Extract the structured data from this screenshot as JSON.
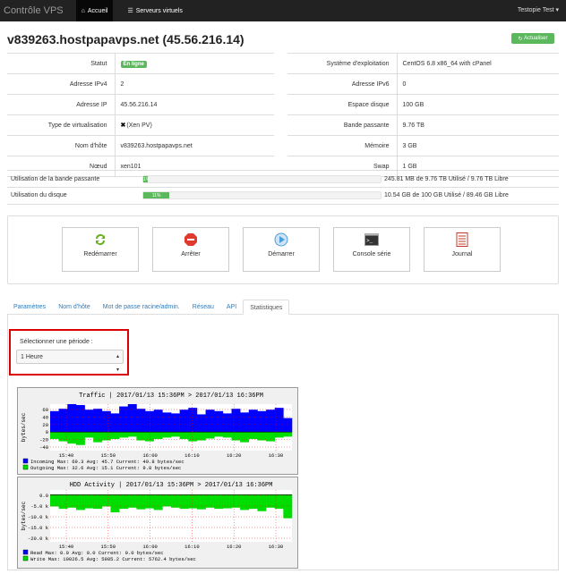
{
  "navbar": {
    "brand": "Contrôle VPS",
    "home": "Accueil",
    "servers": "Serveurs virtuels",
    "user": "Testopie Test ▾"
  },
  "header": {
    "title": "v839263.hostpapavps.net (45.56.216.14)",
    "refresh": "Actualiser"
  },
  "left_info": [
    {
      "label": "Statut",
      "value": "En ligne",
      "badge": true
    },
    {
      "label": "Adresse IPv4",
      "value": "2"
    },
    {
      "label": "Adresse IP",
      "value": "45.56.216.14"
    },
    {
      "label": "Type de virtualisation",
      "value": "(Xen PV)",
      "icon": "x-icon"
    },
    {
      "label": "Nom d'hôte",
      "value": "v839263.hostpapavps.net"
    },
    {
      "label": "Nœud",
      "value": "xen101"
    }
  ],
  "right_info": [
    {
      "label": "Système d'exploitation",
      "value": "CentOS 6.8 x86_64 with cPanel"
    },
    {
      "label": "Adresse IPv6",
      "value": "0"
    },
    {
      "label": "Espace disque",
      "value": "100 GB"
    },
    {
      "label": "Bande passante",
      "value": "9.76 TB"
    },
    {
      "label": "Mémoire",
      "value": "3 GB"
    },
    {
      "label": "Swap",
      "value": "1 GB"
    }
  ],
  "usage": [
    {
      "label": "Utilisation de la bande passante",
      "percent": 0.02,
      "bar_label": "1%",
      "text": "245.81 MB de 9.76 TB Utilisé / 9.76 TB Libre"
    },
    {
      "label": "Utilisation du disque",
      "percent": 0.11,
      "bar_label": "11%",
      "text": "10.54 GB de 100 GB Utilisé / 89.46 GB Libre"
    }
  ],
  "actions": [
    {
      "label": "Redémarrer",
      "icon": "refresh-icon",
      "color": "#6ab023"
    },
    {
      "label": "Arrêter",
      "icon": "stop-icon",
      "color": "#e03a2e"
    },
    {
      "label": "Démarrer",
      "icon": "play-icon",
      "color": "#4a9fd8"
    },
    {
      "label": "Console série",
      "icon": "terminal-icon",
      "color": "#333333"
    },
    {
      "label": "Journal",
      "icon": "notebook-icon",
      "color": "#c0392b"
    }
  ],
  "tabs": [
    "Paramètres",
    "Nom d'hôte",
    "Mot de passe racine/admin.",
    "Réseau",
    "API",
    "Statistiques"
  ],
  "active_tab": "Statistiques",
  "period": {
    "label": "Sélectionner une période :",
    "selected": "1 Heure"
  },
  "traffic": {
    "title": "Traffic | 2017/01/13 15:36PM > 2017/01/13 16:36PM",
    "ylabel": "bytes/sec",
    "yticks": [
      "60",
      "40",
      "20",
      "0",
      "-20",
      "-40"
    ],
    "xticks": [
      "15:40",
      "15:50",
      "16:00",
      "16:10",
      "16:20",
      "16:30"
    ],
    "legend": [
      {
        "color": "#0000ff",
        "text": "Incoming  Max:  69.3    Avg:  45.7    Current:  49.8    bytes/sec"
      },
      {
        "color": "#00dd00",
        "text": "Outgoing  Max:  32.6    Avg:  15.1    Current:   9.8    bytes/sec"
      }
    ],
    "chart_data": {
      "type": "area",
      "title": "Traffic | 2017/01/13 15:36PM > 2017/01/13 16:36PM",
      "ylabel": "bytes/sec",
      "ylim": [
        -40,
        60
      ],
      "series": [
        {
          "name": "Incoming",
          "values": [
            45,
            50,
            60,
            58,
            48,
            50,
            45,
            40,
            55,
            60,
            50,
            45,
            48,
            42,
            40,
            48,
            52,
            38,
            48,
            45,
            40,
            50,
            42,
            48,
            45,
            48,
            52,
            30
          ]
        },
        {
          "name": "Outgoing",
          "values": [
            -15,
            -20,
            -25,
            -28,
            -12,
            -22,
            -18,
            -15,
            -12,
            -10,
            -18,
            -20,
            -15,
            -12,
            -10,
            -15,
            -20,
            -18,
            -14,
            -10,
            -12,
            -18,
            -22,
            -15,
            -18,
            -20,
            -12,
            -10
          ]
        }
      ]
    }
  },
  "hdd": {
    "title": "HDD Activity | 2017/01/13 15:36PM > 2017/01/13 16:36PM",
    "ylabel": "bytes/sec",
    "yticks": [
      "0.0",
      "-5.0 k",
      "-10.0 k",
      "-15.0 k",
      "-20.0 k"
    ],
    "xticks": [
      "15:40",
      "15:50",
      "16:00",
      "16:10",
      "16:20",
      "16:30"
    ],
    "legend": [
      {
        "color": "#0000ff",
        "text": "Read   Max:    0.0    Avg:    0.0    Current:    0.0   bytes/sec"
      },
      {
        "color": "#00dd00",
        "text": "Write  Max: 10026.5    Avg:  5985.2    Current: 5762.4   bytes/sec"
      }
    ],
    "chart_data": {
      "type": "area",
      "title": "HDD Activity | 2017/01/13 15:36PM > 2017/01/13 16:36PM",
      "ylabel": "bytes/sec",
      "ylim": [
        -20000,
        2000
      ],
      "series": [
        {
          "name": "Read",
          "values": [
            0,
            0,
            0,
            0,
            0,
            0,
            0,
            0,
            0,
            0,
            0,
            0,
            0,
            0,
            0,
            0,
            0,
            0,
            0,
            0,
            0,
            0,
            0,
            0,
            0,
            0,
            0,
            0
          ]
        },
        {
          "name": "Write",
          "values": [
            -5000,
            -6000,
            -5500,
            -6500,
            -5800,
            -6000,
            -5000,
            -7500,
            -6000,
            -5500,
            -6200,
            -5800,
            -6500,
            -5000,
            -5500,
            -6000,
            -5800,
            -6200,
            -5500,
            -6000,
            -5800,
            -5500,
            -6500,
            -6000,
            -7000,
            -5500,
            -6000,
            -10000
          ]
        }
      ]
    }
  }
}
